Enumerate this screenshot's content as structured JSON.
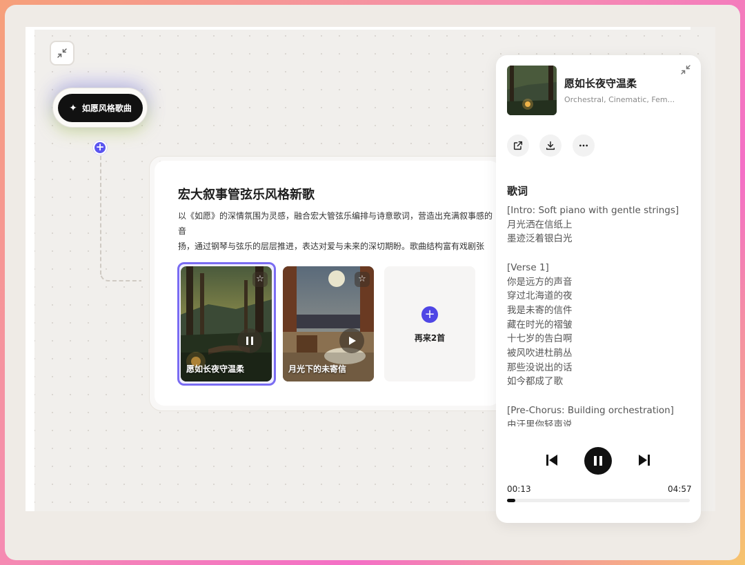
{
  "node": {
    "pill_label": "如愿风格歌曲",
    "plus_symbol": "+"
  },
  "card": {
    "title": "宏大叙事管弦乐风格新歌",
    "description": "以《如愿》的深情氛围为灵感，融合宏大管弦乐编排与诗意歌词，营造出充满叙事感的音\n扬，通过钢琴与弦乐的层层推进，表达对爱与未来的深切期盼。歌曲结构富有戏剧张力，\n候。",
    "songs": [
      {
        "title": "愿如长夜守温柔",
        "state": "playing",
        "selected": true
      },
      {
        "title": "月光下的未寄信",
        "state": "paused",
        "selected": false
      }
    ],
    "more_label": "再来2首"
  },
  "player": {
    "title": "愿如长夜守温柔",
    "tags": "Orchestral, Cinematic, Fem...",
    "lyrics_heading": "歌词",
    "lyrics": "[Intro: Soft piano with gentle strings]\n月光洒在信纸上\n墨迹泛着银白光\n\n[Verse 1]\n你是远方的声音\n穿过北海道的夜\n我是未寄的信件\n藏在时光的褶皱\n十七岁的告白啊\n被风吹进杜鹃丛\n那些没说出的话\n如今都成了歌\n\n[Pre-Chorus: Building orchestration]\n由汗里你轻声说",
    "time_current": "00:13",
    "time_total": "04:57",
    "progress_fraction": 0.044
  },
  "colors": {
    "accent": "#4f46e5",
    "selected_border": "#7a6cf2"
  }
}
